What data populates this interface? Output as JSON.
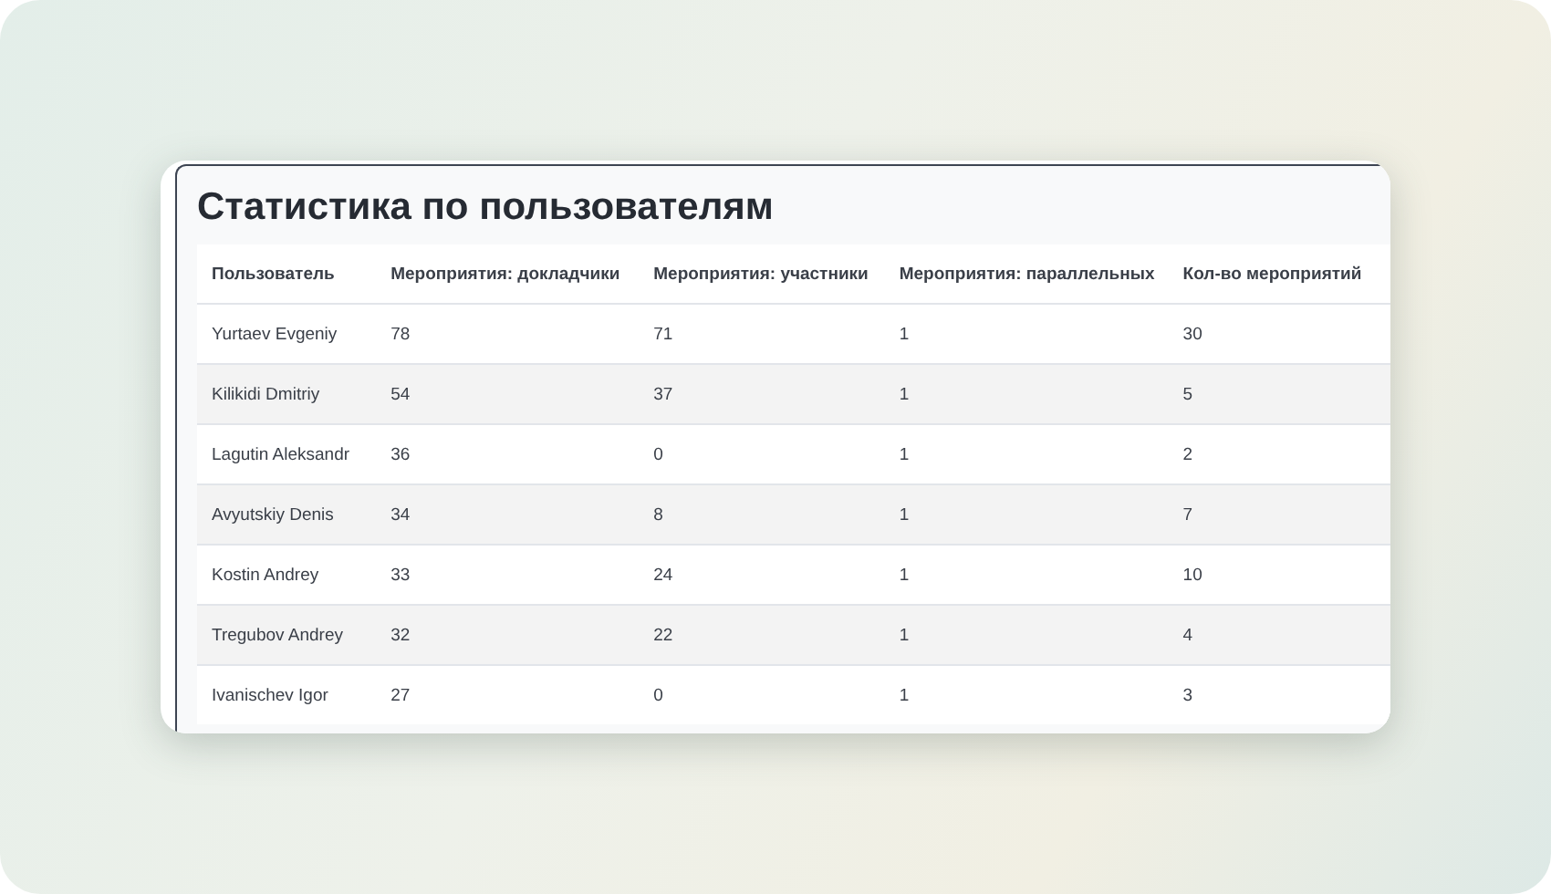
{
  "title": "Статистика по пользователям",
  "table": {
    "columns": [
      "Пользователь",
      "Мероприятия: докладчики",
      "Мероприятия: участники",
      "Мероприятия: параллельных",
      "Кол-во мероприятий"
    ],
    "rows": [
      [
        "Yurtaev Evgeniy",
        "78",
        "71",
        "1",
        "30"
      ],
      [
        "Kilikidi Dmitriy",
        "54",
        "37",
        "1",
        "5"
      ],
      [
        "Lagutin Aleksandr",
        "36",
        "0",
        "1",
        "2"
      ],
      [
        "Avyutskiy Denis",
        "34",
        "8",
        "1",
        "7"
      ],
      [
        "Kostin Andrey",
        "33",
        "24",
        "1",
        "10"
      ],
      [
        "Tregubov Andrey",
        "32",
        "22",
        "1",
        "4"
      ],
      [
        "Ivanischev Igor",
        "27",
        "0",
        "1",
        "3"
      ]
    ]
  }
}
